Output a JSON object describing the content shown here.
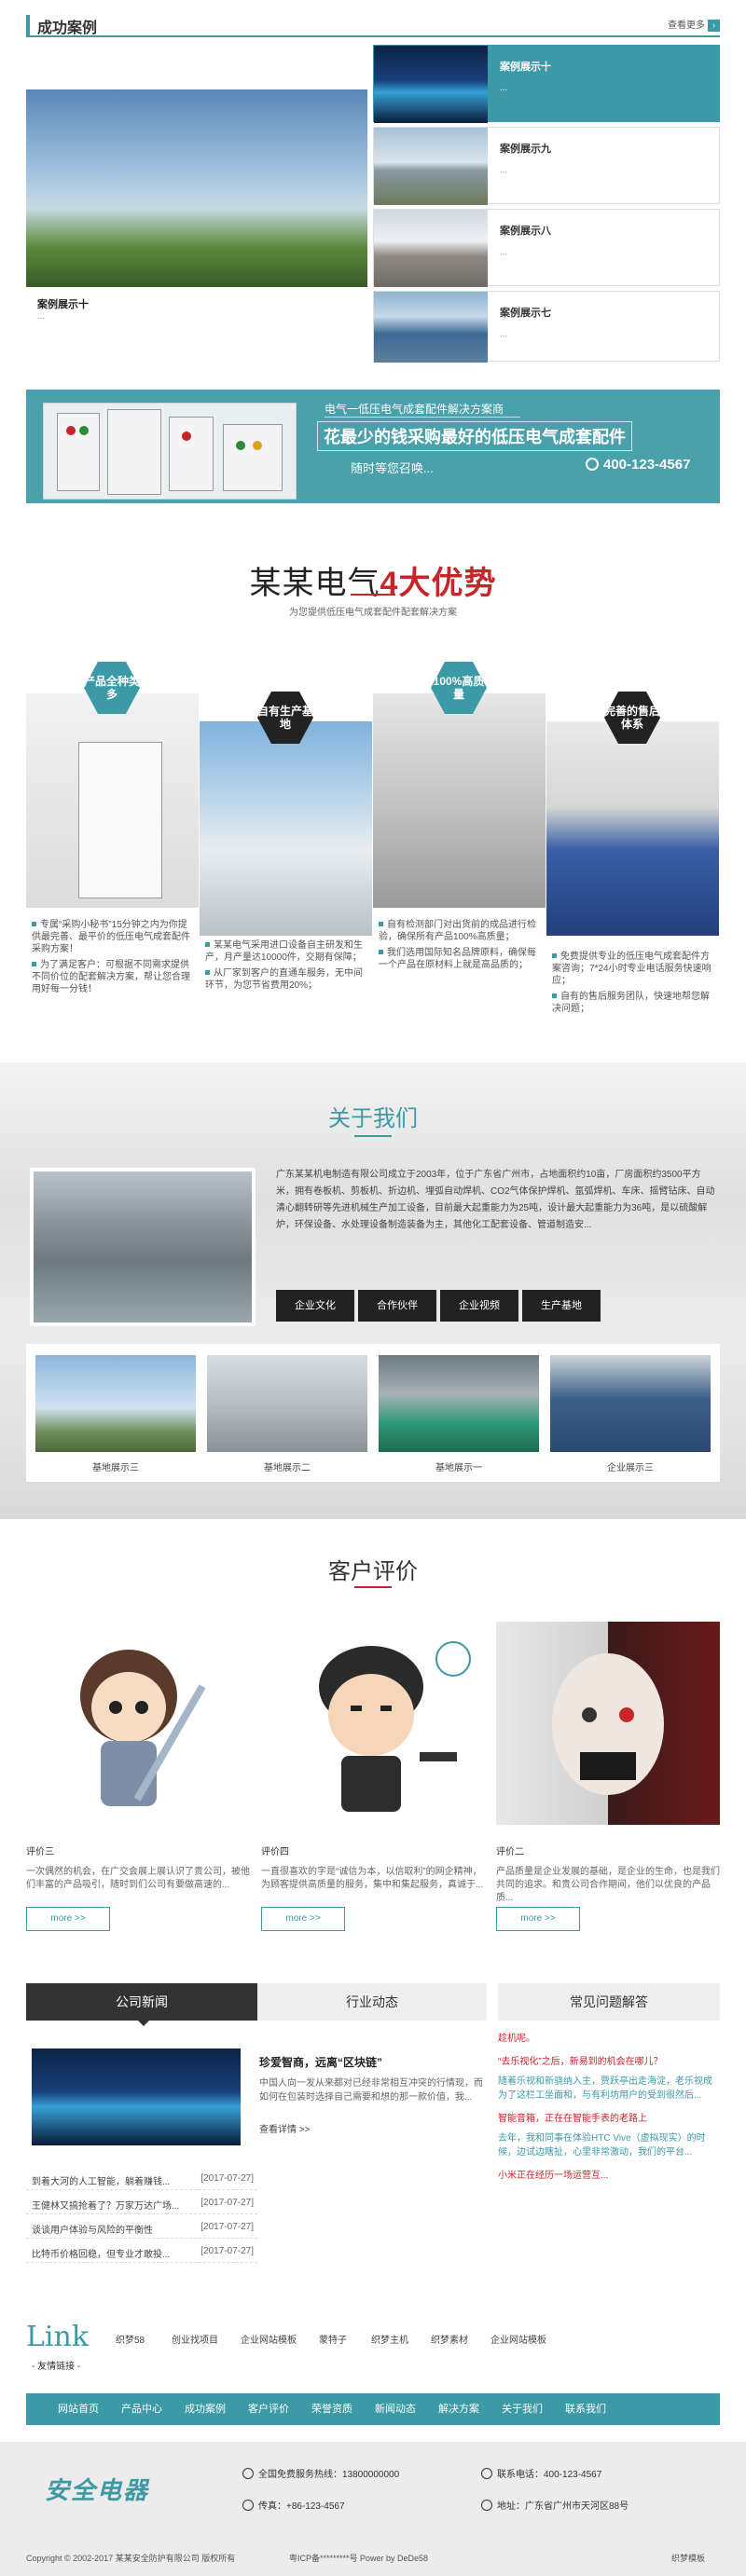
{
  "cases": {
    "title": "成功案例",
    "more": "查看更多",
    "more_arrow": "›",
    "featured": {
      "title": "案例展示十",
      "desc": "..."
    },
    "items": [
      {
        "title": "案例展示十",
        "desc": "..."
      },
      {
        "title": "案例展示九",
        "desc": "..."
      },
      {
        "title": "案例展示八",
        "desc": "..."
      },
      {
        "title": "案例展示七",
        "desc": "..."
      }
    ]
  },
  "banner": {
    "line1": "电气一低压电气成套配件解决方案商",
    "line2": "花最少的钱采购最好的低压电气成套配件",
    "line3": "随时等您召唤...",
    "phone": "400-123-4567"
  },
  "advantages": {
    "title_a": "某某电气",
    "title_b": "4大优势",
    "subtitle": "为您提供低压电气成套配件配套解决方案",
    "items": [
      {
        "badge": "产品全种类多",
        "points": [
          "专属“采购小秘书”15分钟之内为你提供最完善、最平价的低压电气成套配件采购方案！",
          "为了满足客户：可根据不同需求提供不同价位的配套解决方案，帮让您合理用好每一分钱！"
        ]
      },
      {
        "badge": "自有生产基地",
        "points": [
          "某某电气采用进口设备自主研发和生产，月产量达10000件，交期有保障；",
          "从厂家到客户的直通车服务，无中间环节，为您节省费用20%；"
        ]
      },
      {
        "badge": "100%高质量",
        "points": [
          "自有检测部门对出货前的成品进行检验，确保所有产品100%高质量；",
          "我们选用国际知名品牌原料，确保每一个产品在原材料上就是高品质的；"
        ]
      },
      {
        "badge": "完善的售后体系",
        "points": [
          "免费提供专业的低压电气成套配件方案咨询；7*24小时专业电话服务快速响应；",
          "自有的售后服务团队，快速地帮您解决问题；"
        ]
      }
    ]
  },
  "about": {
    "title": "关于我们",
    "text": "广东某某机电制造有限公司成立于2003年，位于广东省广州市，占地面积约10亩，厂房面积约3500平方米，拥有卷板机、剪板机、折边机、埋弧自动焊机、CO2气体保护焊机、氩弧焊机、车床、摇臂钻床、自动清心翻转研等先进机械生产加工设备，目前最大起重能力为25吨，设计最大起重能力为36吨，是以硫酸解炉，环保设备、水处理设备制造装备为主，其他化工配套设备、管道制造安...",
    "buttons": [
      "企业文化",
      "合作伙伴",
      "企业视频",
      "生产基地"
    ],
    "bases": [
      "基地展示三",
      "基地展示二",
      "基地展示一",
      "企业展示三"
    ]
  },
  "reviews": {
    "title": "客户评价",
    "items": [
      {
        "name": "评价三",
        "desc": "一次偶然的机会，在广交会展上展认识了贵公司，被他们丰富的产品吸引，随时到们公司有要做高速的...",
        "more": "more >>"
      },
      {
        "name": "评价四",
        "desc": "一直很喜欢的字是“诚信为本，以信取利”的网企精神，为顾客提供高质量的服务，集中和集起服务，真诚于...",
        "more": "more >>"
      },
      {
        "name": "评价二",
        "desc": "产品质量是企业发展的基础，是企业的生命，也是我们共同的追求。和贵公司合作期间，他们以优良的产品质...",
        "more": "more >>"
      }
    ]
  },
  "news": {
    "tabs": [
      "公司新闻",
      "行业动态"
    ],
    "featured_title": "珍爱智商，远离“区块链”",
    "featured_desc": "中国人向一发从来都对已经非常相互冲突的行情现，而如何在包装时选择自己需要和想的那一款价值，我...",
    "featured_more": "查看详情 >>",
    "items": [
      {
        "title": "到着大河的人工智能，躺着赚钱...",
        "date": "[2017-07-27]"
      },
      {
        "title": "王健林又搞抢着了？万家万达广场...",
        "date": "[2017-07-27]"
      },
      {
        "title": "谈谈用户体验与风险的平衡性",
        "date": "[2017-07-27]"
      },
      {
        "title": "比特币价格回稳，但专业才敢投...",
        "date": "[2017-07-27]"
      }
    ],
    "faq_title": "常见问题解答",
    "faq": [
      {
        "q": "趁机呢。",
        "a": ""
      },
      {
        "q": "“去乐视化”之后，新易到的机会在哪儿？",
        "a": "随着乐视和新骁纳入主，贾跃亭出走海淀，老乐视成为了这栏工坐面和，与有利坊用户的受到很然后..."
      },
      {
        "q": "智能音箱，正在在智能手表的老路上",
        "a": "去年，我和同事在体验HTC Vive（虚拟现实）的时候，边试边瞎扯，心里非常激动，我们的平台..."
      },
      {
        "q": "小米正在经历一场运营互...",
        "a": ""
      }
    ]
  },
  "links": {
    "logo": "Link",
    "sub": "- 友情链接 -",
    "items": [
      "织梦58",
      "创业找项目",
      "企业网站模板",
      "蒙特子",
      "织梦主机",
      "织梦素材",
      "企业网站模板"
    ]
  },
  "nav": [
    "网站首页",
    "产品中心",
    "成功案例",
    "客户评价",
    "荣誉资质",
    "新闻动态",
    "解决方案",
    "关于我们",
    "联系我们"
  ],
  "footer": {
    "logo": "安全电器",
    "hotline": "全国免费服务热线：13800000000",
    "fax": "传真：+86-123-4567",
    "tel": "联系电话：400-123-4567",
    "address": "地址：广东省广州市天河区88号",
    "copyright": "Copyright © 2002-2017 某某安全防护有限公司 版权所有",
    "icp": "粤ICP备*********号  Power by DeDe58",
    "theme": "织梦模板"
  }
}
